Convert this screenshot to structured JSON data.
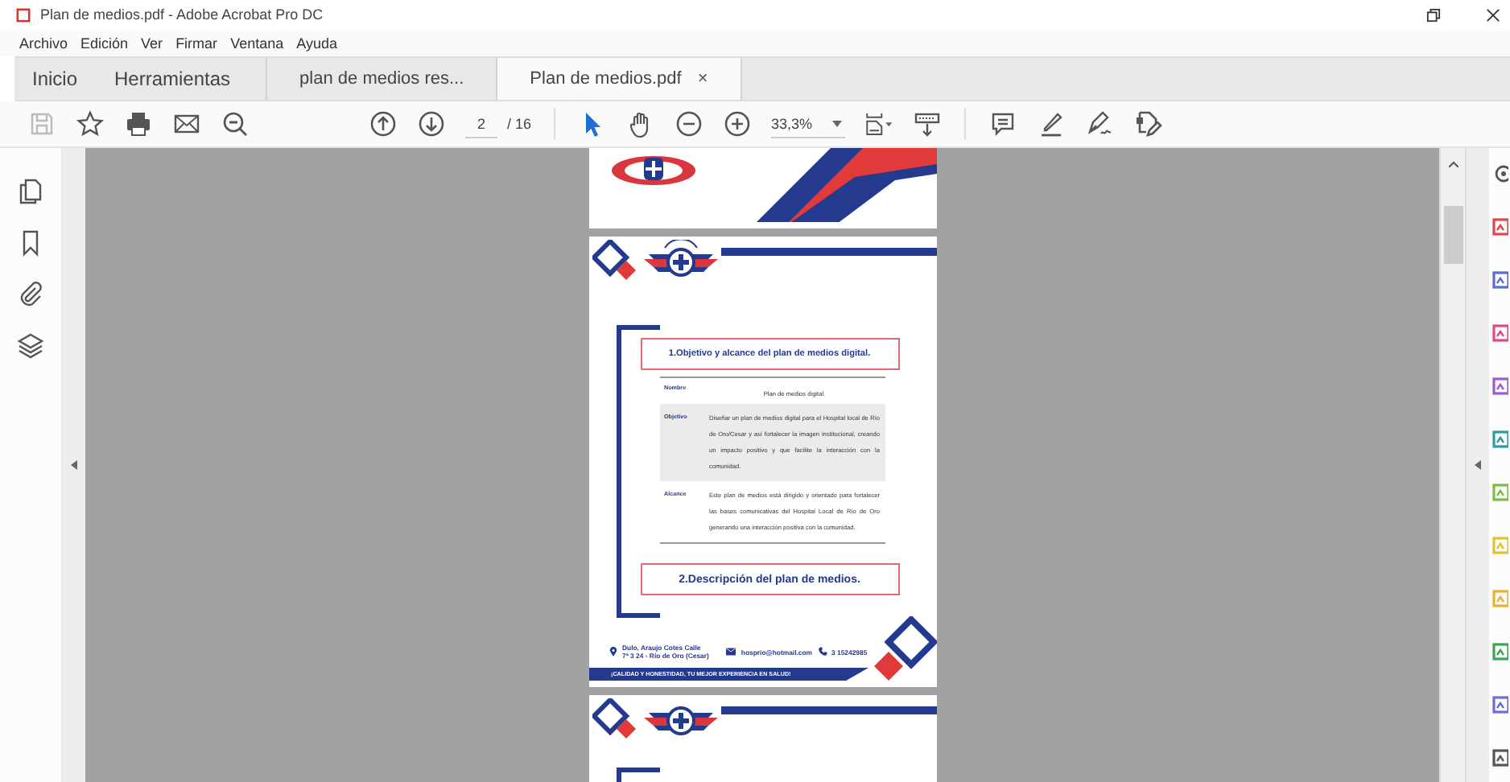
{
  "window": {
    "title": "Plan de medios.pdf - Adobe Acrobat Pro DC"
  },
  "menu": [
    "Archivo",
    "Edición",
    "Ver",
    "Firmar",
    "Ventana",
    "Ayuda"
  ],
  "tabs": [
    {
      "label": "Inicio",
      "kind": "app",
      "selected": false
    },
    {
      "label": "Herramientas",
      "kind": "app",
      "selected": false
    },
    {
      "label": "plan de medios res...",
      "kind": "doc",
      "selected": false
    },
    {
      "label": "Plan de medios.pdf",
      "kind": "doc",
      "selected": true,
      "close": "×"
    }
  ],
  "toolbar": {
    "page": "2",
    "page_total": "/ 16",
    "zoom": "33,3%"
  },
  "document": {
    "heading_1": "1.Objetivo y alcance del plan de medios digital.",
    "table": {
      "header_label": "Nombre",
      "header_value": "Plan de medios digital.",
      "rows": [
        {
          "label": "Objetivo",
          "text": "Diseñar un plan de medios digital para el Hospital local de Río de Oro/Cesar y así fortalecer la imagen institucional, creando un impacto positivo y que facilite la interacción con la comunidad.",
          "shaded": true
        },
        {
          "label": "Alcance",
          "text": "Este plan de medios está dirigido y orientado para fortalecer las bases comunicativas del Hospital Local de Río de Oro generando una interacción positiva con la comunidad.",
          "shaded": false
        }
      ]
    },
    "heading_2": "2.Descripción del plan de medios.",
    "footer": {
      "address": [
        "Dulo, Araujo Cotes Calle",
        "7ª 3 24 - Río de Oro (Cesar)"
      ],
      "email": "hosprio@hotmail.com",
      "phone": "3 15242985",
      "slogan": "¡CALIDAD Y HONESTIDAD, TU MEJOR EXPERIENCIA EN SALUD!"
    }
  },
  "right_tools": [
    {
      "color": "#e0464a"
    },
    {
      "color": "#5a6cd8"
    },
    {
      "color": "#e2478a"
    },
    {
      "color": "#9b59d6"
    },
    {
      "color": "#2a9ca3"
    },
    {
      "color": "#7dbb43"
    },
    {
      "color": "#e3c22a"
    },
    {
      "color": "#e8b32a"
    },
    {
      "color": "#3aa655"
    },
    {
      "color": "#6c6fd6"
    },
    {
      "color": "#555555"
    }
  ]
}
